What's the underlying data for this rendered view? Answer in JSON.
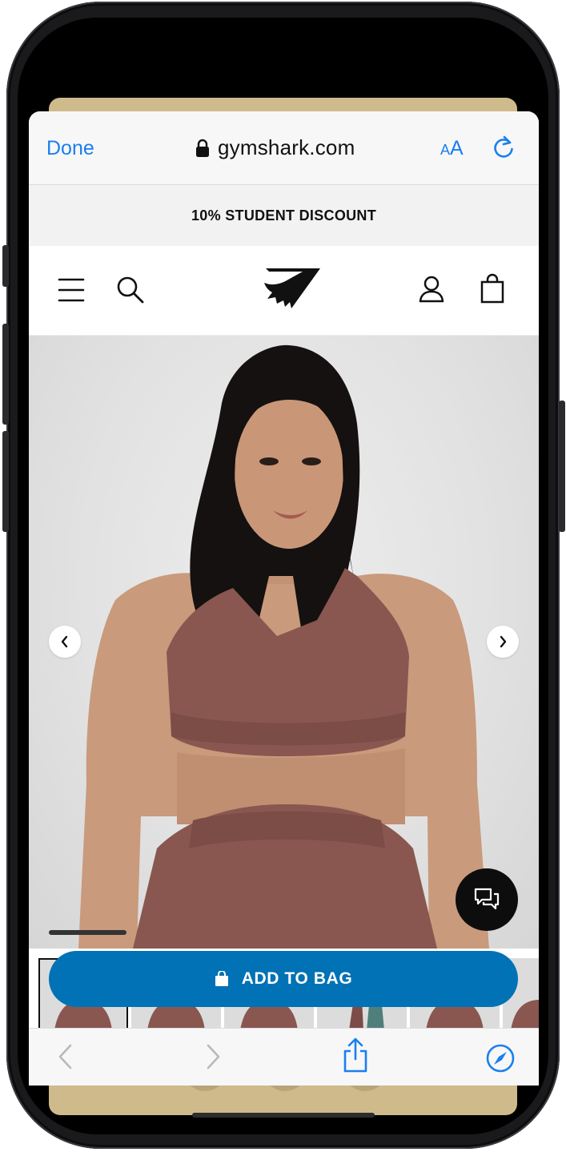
{
  "browser": {
    "done_label": "Done",
    "url": "gymshark.com",
    "text_size_label_small": "A",
    "text_size_label_large": "A"
  },
  "promo": {
    "text": "10% STUDENT DISCOUNT"
  },
  "header": {
    "icons": [
      "menu-icon",
      "search-icon",
      "gymshark-logo",
      "account-icon",
      "bag-icon"
    ]
  },
  "product": {
    "image_description_icon": "product-photo",
    "carousel_progress": 0.15,
    "thumbnail_count": 6,
    "add_to_bag_label": "ADD TO BAG"
  },
  "toolbar": {
    "icons": [
      "back-icon",
      "forward-icon",
      "share-icon",
      "compass-icon"
    ]
  },
  "colors": {
    "accent": "#1a7ff0",
    "cta": "#0072b5",
    "frame_back": "#cfba8c"
  }
}
